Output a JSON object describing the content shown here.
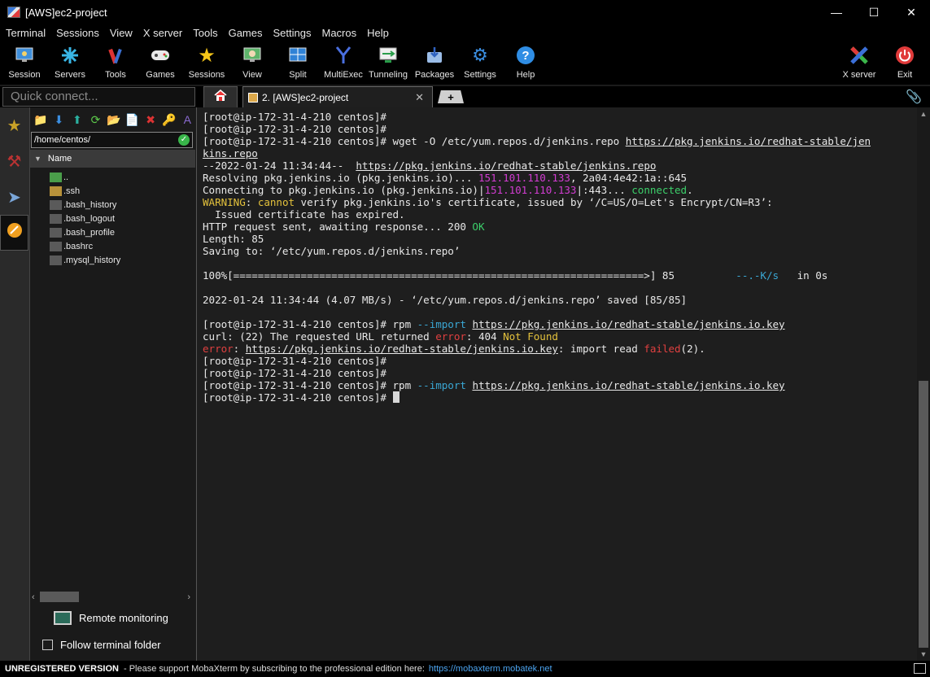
{
  "window": {
    "title": "[AWS]ec2-project"
  },
  "menu": [
    "Terminal",
    "Sessions",
    "View",
    "X server",
    "Tools",
    "Games",
    "Settings",
    "Macros",
    "Help"
  ],
  "toolbar": {
    "session": "Session",
    "servers": "Servers",
    "tools": "Tools",
    "games": "Games",
    "sessions": "Sessions",
    "view": "View",
    "split": "Split",
    "multiexec": "MultiExec",
    "tunneling": "Tunneling",
    "packages": "Packages",
    "settings": "Settings",
    "help": "Help",
    "xserver": "X server",
    "exit": "Exit"
  },
  "quick_connect": {
    "placeholder": "Quick connect..."
  },
  "tabs": {
    "session_tab": "2. [AWS]ec2-project"
  },
  "sftp": {
    "path": "/home/centos/",
    "column": "Name",
    "files": [
      "..",
      ".ssh",
      ".bash_history",
      ".bash_logout",
      ".bash_profile",
      ".bashrc",
      ".mysql_history"
    ],
    "remote_monitoring": "Remote monitoring",
    "follow_folder": "Follow terminal folder"
  },
  "terminal": {
    "prompt": "[root@ip-172-31-4-210 centos]#",
    "lines": {
      "wget_cmd": " wget -O /etc/yum.repos.d/jenkins.repo ",
      "wget_url_a": "https://pkg.jenkins.io/redhat-stable/jen",
      "wget_url_b": "kins.repo",
      "date1": "--2022-01-24 11:34:44--  ",
      "url1": "https://pkg.jenkins.io/redhat-stable/jenkins.repo",
      "resolving": "Resolving pkg.jenkins.io (pkg.jenkins.io)... ",
      "ip1": "151.101.110.133",
      "ipv6": ", 2a04:4e42:1a::645",
      "connecting": "Connecting to pkg.jenkins.io (pkg.jenkins.io)|",
      "ip2": "151.101.110.133",
      "port": "|:443... ",
      "connected": "connected",
      "warning": "WARNING",
      "cannot_prefix": ": ",
      "cannot": "cannot",
      "verify": " verify pkg.jenkins.io's certificate, issued by ‘/C=US/O=Let's Encrypt/CN=R3’:",
      "expired": "  Issued certificate has expired.",
      "http_sent": "HTTP request sent, awaiting response... 200 ",
      "ok": "OK",
      "length": "Length: 85",
      "saving": "Saving to: ‘/etc/yum.repos.d/jenkins.repo’",
      "progress_a": "100%[===================================================================>] 85          ",
      "progress_b": "--.-K/s",
      "progress_c": "   in 0s",
      "saved": "2022-01-24 11:34:44 (4.07 MB/s) - ‘/etc/yum.repos.d/jenkins.repo’ saved [85/85]",
      "rpm_a": " rpm ",
      "rpm_flag": "--import",
      "rpm_url": "https://pkg.jenkins.io/redhat-stable/jenkins.io.key",
      "curl_a": "curl: (22) The requested URL returned ",
      "curl_error": "error",
      "curl_b": ": 404 ",
      "not_found": "Not Found",
      "err_word": "error",
      "err_url": "https://pkg.jenkins.io/redhat-stable/jenkins.io.key",
      "err_b": ": import read ",
      "failed": "failed",
      "err_c": "(2)."
    }
  },
  "status": {
    "unregistered": "UNREGISTERED VERSION",
    "support": " -  Please support MobaXterm by subscribing to the professional edition here:",
    "link": "https://mobaxterm.mobatek.net"
  }
}
